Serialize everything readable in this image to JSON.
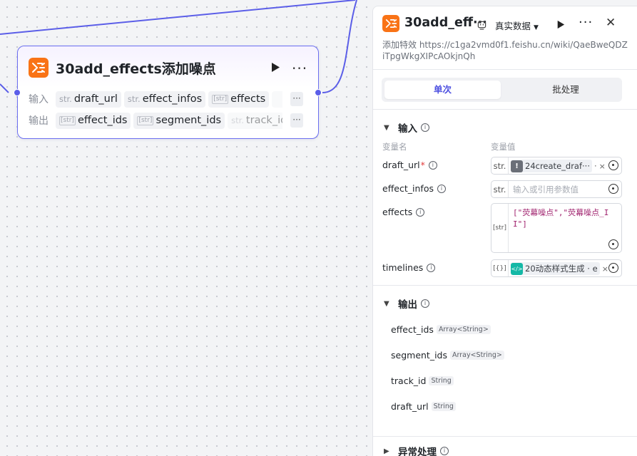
{
  "node": {
    "title": "30add_effects添加噪点",
    "input_label": "输入",
    "output_label": "输出",
    "inputs": [
      {
        "type": "str.",
        "name": "draft_url"
      },
      {
        "type": "str.",
        "name": "effect_infos"
      },
      {
        "type": "[str]",
        "name": "effects"
      }
    ],
    "outputs": [
      {
        "type": "[str]",
        "name": "effect_ids"
      },
      {
        "type": "[str]",
        "name": "segment_ids"
      },
      {
        "type": "str.",
        "name": "track_id"
      }
    ],
    "more_label": "···"
  },
  "panel": {
    "title": "30add_eff···",
    "mode": "真实数据",
    "description": "添加特效 https://c1ga2vmd0f1.feishu.cn/wiki/QaeBweQDZiTpgWkgXIPcAOkjnQh",
    "tabs": [
      "单次",
      "批处理"
    ],
    "input_section": "输入",
    "col_name": "变量名",
    "col_value": "变量值",
    "params": {
      "draft_url": {
        "name": "draft_url",
        "required": "*",
        "type": "str.",
        "ref": "24create_draf···",
        "sep": "·"
      },
      "effect_infos": {
        "name": "effect_infos",
        "type": "str.",
        "placeholder": "输入或引用参数值"
      },
      "effects": {
        "name": "effects",
        "type": "[str]",
        "value": "[\"荧幕噪点\",\"荧幕噪点_II\"]"
      },
      "timelines": {
        "name": "timelines",
        "type": "[{}]",
        "ref": "20动态样式生成 · e"
      }
    },
    "output_section": "输出",
    "outputs": [
      {
        "name": "effect_ids",
        "type": "Array<String>"
      },
      {
        "name": "segment_ids",
        "type": "Array<String>"
      },
      {
        "name": "track_id",
        "type": "String"
      },
      {
        "name": "draft_url",
        "type": "String"
      }
    ],
    "exception_section": "异常处理"
  },
  "colors": {
    "accent": "#5b5ee8",
    "plugin_orange": "#f97316",
    "ref_teal": "#14b8a6"
  }
}
